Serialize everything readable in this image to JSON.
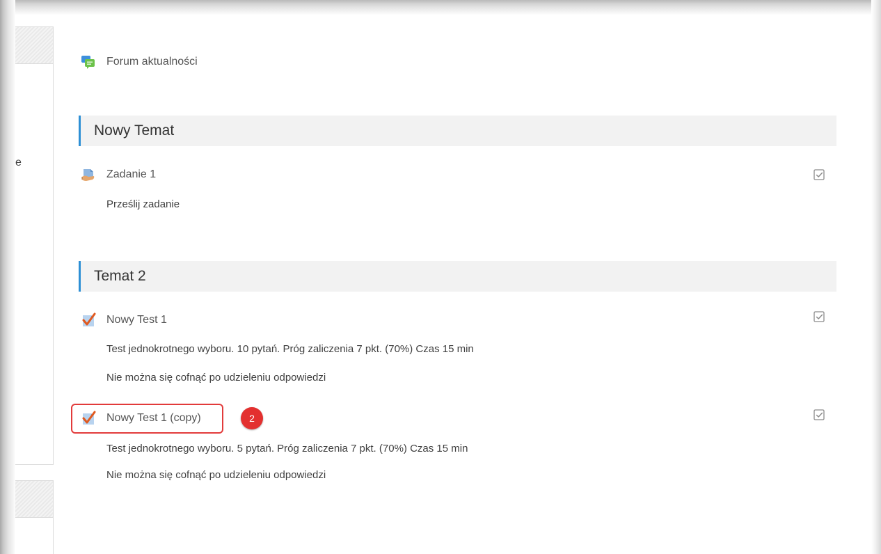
{
  "sidebar": {
    "cut_text": "e"
  },
  "forum": {
    "name": "Forum aktualności",
    "icon": "forum-icon"
  },
  "sections": [
    {
      "title": "Nowy Temat",
      "activities": [
        {
          "name": "Zadanie 1",
          "icon": "assignment-icon",
          "descriptions": [
            "Prześlij zadanie"
          ]
        }
      ]
    },
    {
      "title": "Temat 2",
      "activities": [
        {
          "name": "Nowy Test 1",
          "icon": "quiz-icon",
          "descriptions": [
            "Test jednokrotnego wyboru. 10 pytań. Próg zaliczenia 7 pkt. (70%) Czas 15 min",
            "Nie można się cofnąć po udzieleniu odpowiedzi"
          ]
        },
        {
          "name": "Nowy Test 1 (copy)",
          "icon": "quiz-icon",
          "descriptions": [
            "Test jednokrotnego wyboru. 5 pytań. Próg zaliczenia 7 pkt. (70%) Czas 15 min",
            "Nie można się cofnąć po udzieleniu odpowiedzi"
          ]
        }
      ]
    }
  ],
  "annotation": {
    "badge_number": "2"
  },
  "colors": {
    "section_accent": "#2d8fd5",
    "highlight": "#e23b3b",
    "badge": "#e3302f"
  }
}
